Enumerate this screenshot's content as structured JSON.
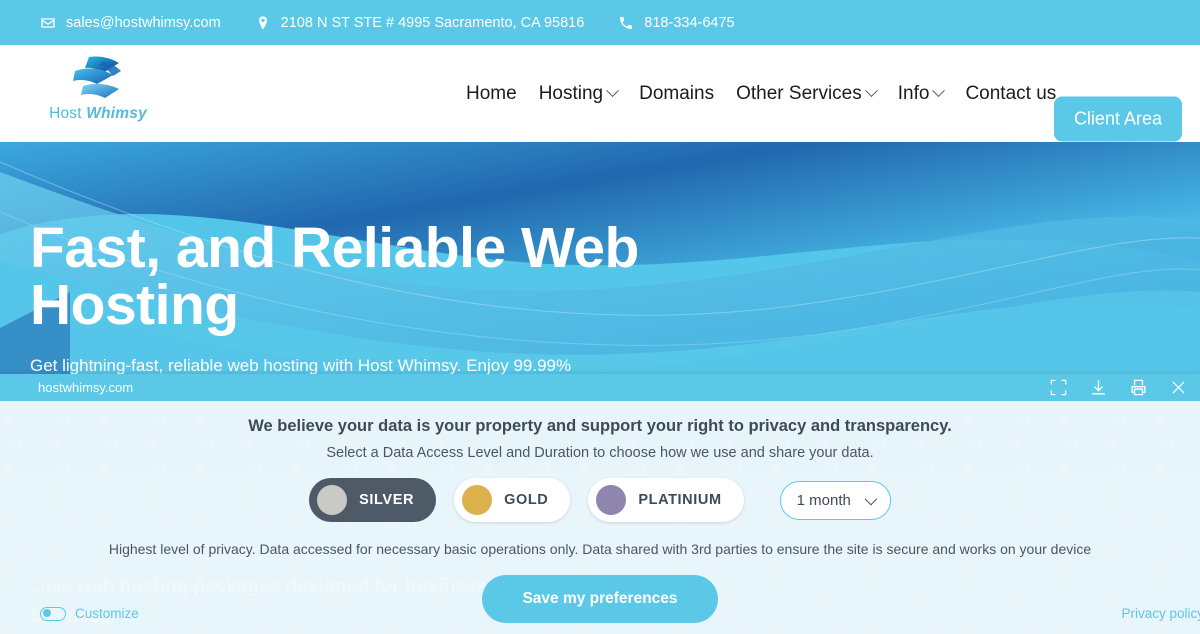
{
  "topbar": {
    "email": "sales@hostwhimsy.com",
    "address": "2108 N ST STE # 4995 Sacramento, CA 95816",
    "phone": "818-334-6475"
  },
  "header": {
    "logo_text_host": "Host",
    "logo_text_whimsy": "Whimsy",
    "nav": [
      {
        "label": "Home",
        "has_dropdown": false
      },
      {
        "label": "Hosting",
        "has_dropdown": true
      },
      {
        "label": "Domains",
        "has_dropdown": false
      },
      {
        "label": "Other Services",
        "has_dropdown": true
      },
      {
        "label": "Info",
        "has_dropdown": true
      },
      {
        "label": "Contact us",
        "has_dropdown": false
      }
    ],
    "client_area_label": "Client Area"
  },
  "hero": {
    "heading": "Fast, and Reliable Web Hosting",
    "subheading": "Get lightning-fast, reliable web hosting with Host Whimsy. Enjoy 99.99%",
    "ghost_paragraph": "...ive web hosting packages designed for businesses and individuals alike. Choose..."
  },
  "dialog": {
    "domain": "hostwhimsy.com",
    "titlebar_icons": [
      "fullscreen-icon",
      "download-icon",
      "print-icon",
      "close-icon"
    ],
    "headline": "We believe your data is your property and support your right to privacy and transparency.",
    "subline": "Select a Data Access Level and Duration to choose how we use and share your data.",
    "levels": [
      {
        "label": "SILVER",
        "color": "#c9c9c6",
        "selected": true
      },
      {
        "label": "GOLD",
        "color": "#dcb14b",
        "selected": false
      },
      {
        "label": "PLATINIUM",
        "color": "#8f86ad",
        "selected": false
      }
    ],
    "duration_value": "1 month",
    "level_description": "Highest level of privacy. Data accessed for necessary basic operations only. Data shared with 3rd parties to ensure the site is secure and works on your device",
    "save_label": "Save my preferences",
    "customize_label": "Customize",
    "customize_enabled": false,
    "privacy_policy_label": "Privacy policy"
  },
  "colors": {
    "accent": "#5bc8e8",
    "hero_bg": "#56c7e9",
    "selected_pill": "#4e5a68",
    "text_dark": "#3e4b58"
  }
}
